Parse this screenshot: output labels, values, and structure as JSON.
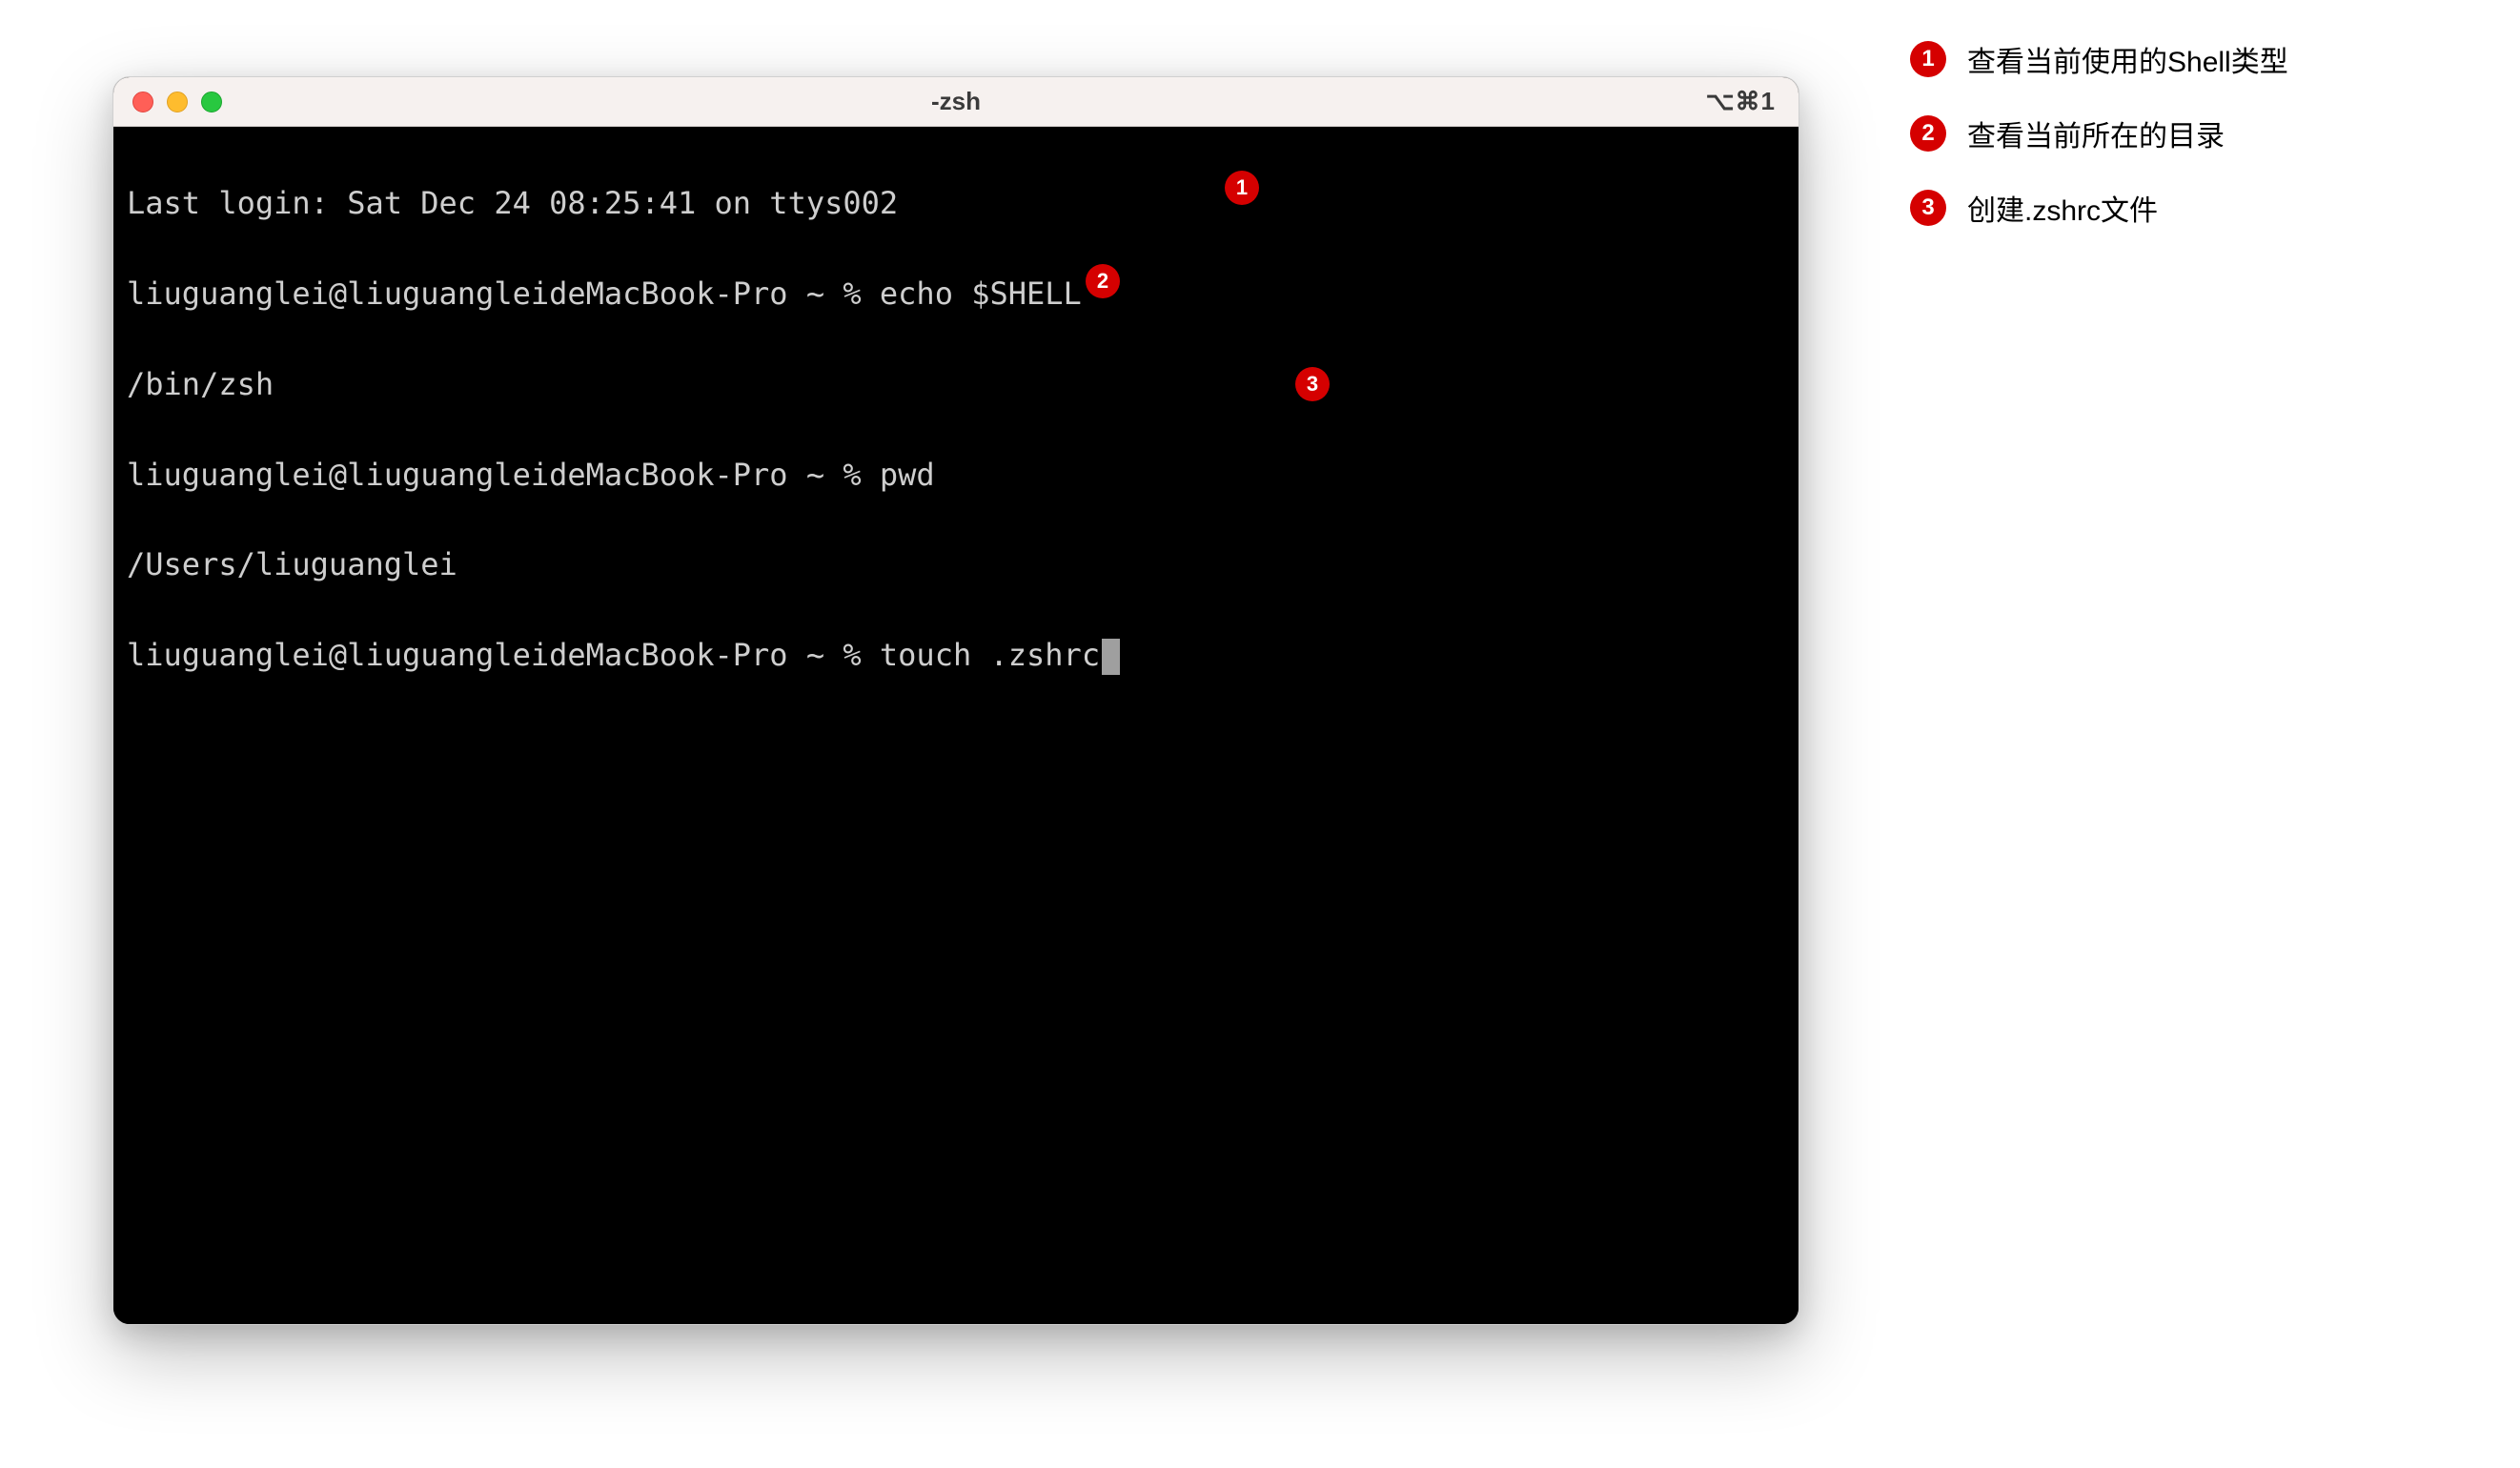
{
  "window": {
    "title": "-zsh",
    "shortcut": "⌥⌘1"
  },
  "terminal": {
    "line1": "Last login: Sat Dec 24 08:25:41 on ttys002",
    "prompt_prefix": "liuguanglei@liuguangleideMacBook-Pro ~ % ",
    "cmd1": "echo $SHELL",
    "out1": "/bin/zsh",
    "cmd2": "pwd",
    "out2": "/Users/liuguanglei",
    "cmd3": "touch .zshrc"
  },
  "callouts": {
    "c1": "1",
    "c2": "2",
    "c3": "3"
  },
  "legend": {
    "items": [
      {
        "num": "1",
        "text": "查看当前使用的Shell类型"
      },
      {
        "num": "2",
        "text": "查看当前所在的目录"
      },
      {
        "num": "3",
        "text": "创建.zshrc文件"
      }
    ]
  }
}
